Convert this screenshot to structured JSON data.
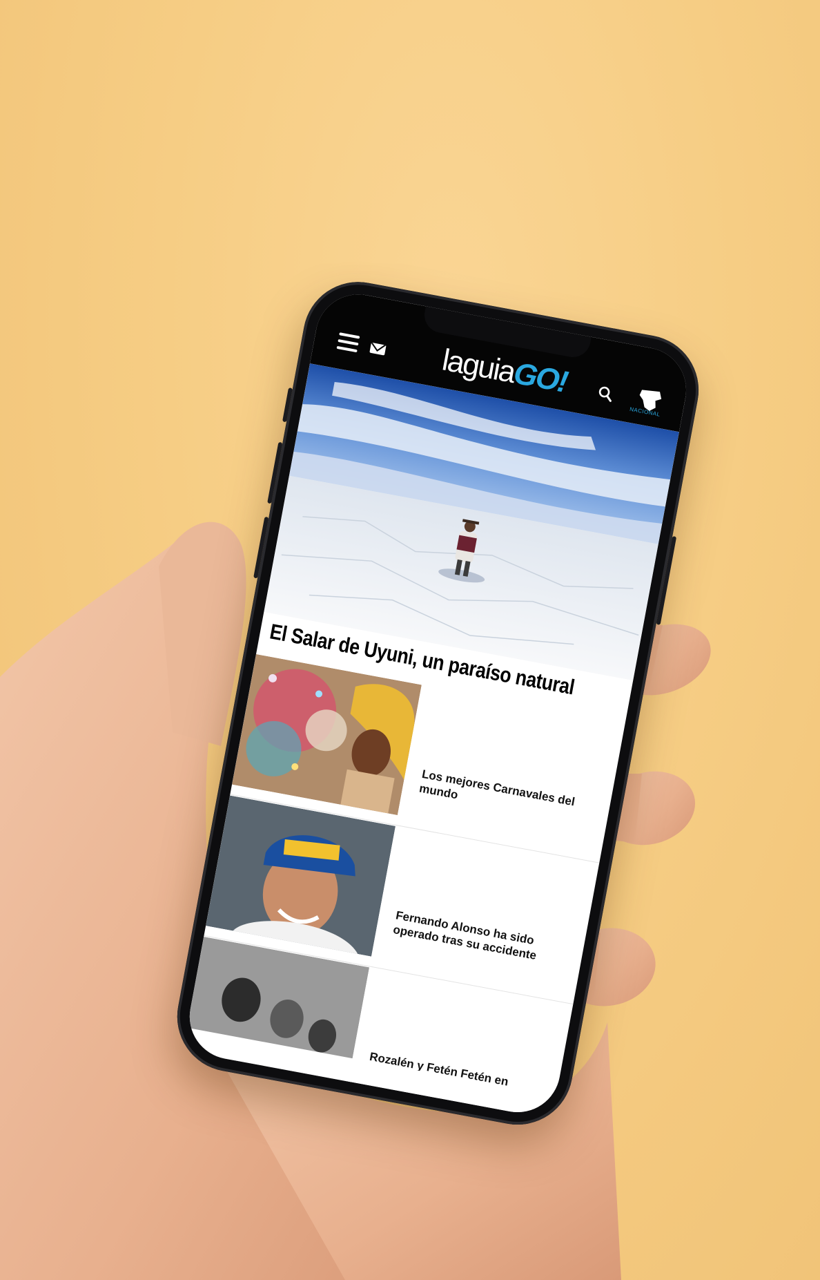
{
  "app": {
    "logo_part1": "laguia",
    "logo_part2": "GO!",
    "region_label": "NACIONAL"
  },
  "header": {
    "icons": [
      "menu-icon",
      "mail-icon",
      "search-icon",
      "region-flag-icon"
    ]
  },
  "hero": {
    "title": "El Salar de Uyuni, un paraíso natural"
  },
  "articles": [
    {
      "title": "Los mejores Carnavales del mundo"
    },
    {
      "title": "Fernando Alonso ha sido operado tras su accidente"
    },
    {
      "title": "Rozalén y Fetén Fetén en #LaResidencia"
    }
  ],
  "colors": {
    "background": "#f5cd85",
    "header": "#050505",
    "brand_accent": "#2aa8e0"
  }
}
